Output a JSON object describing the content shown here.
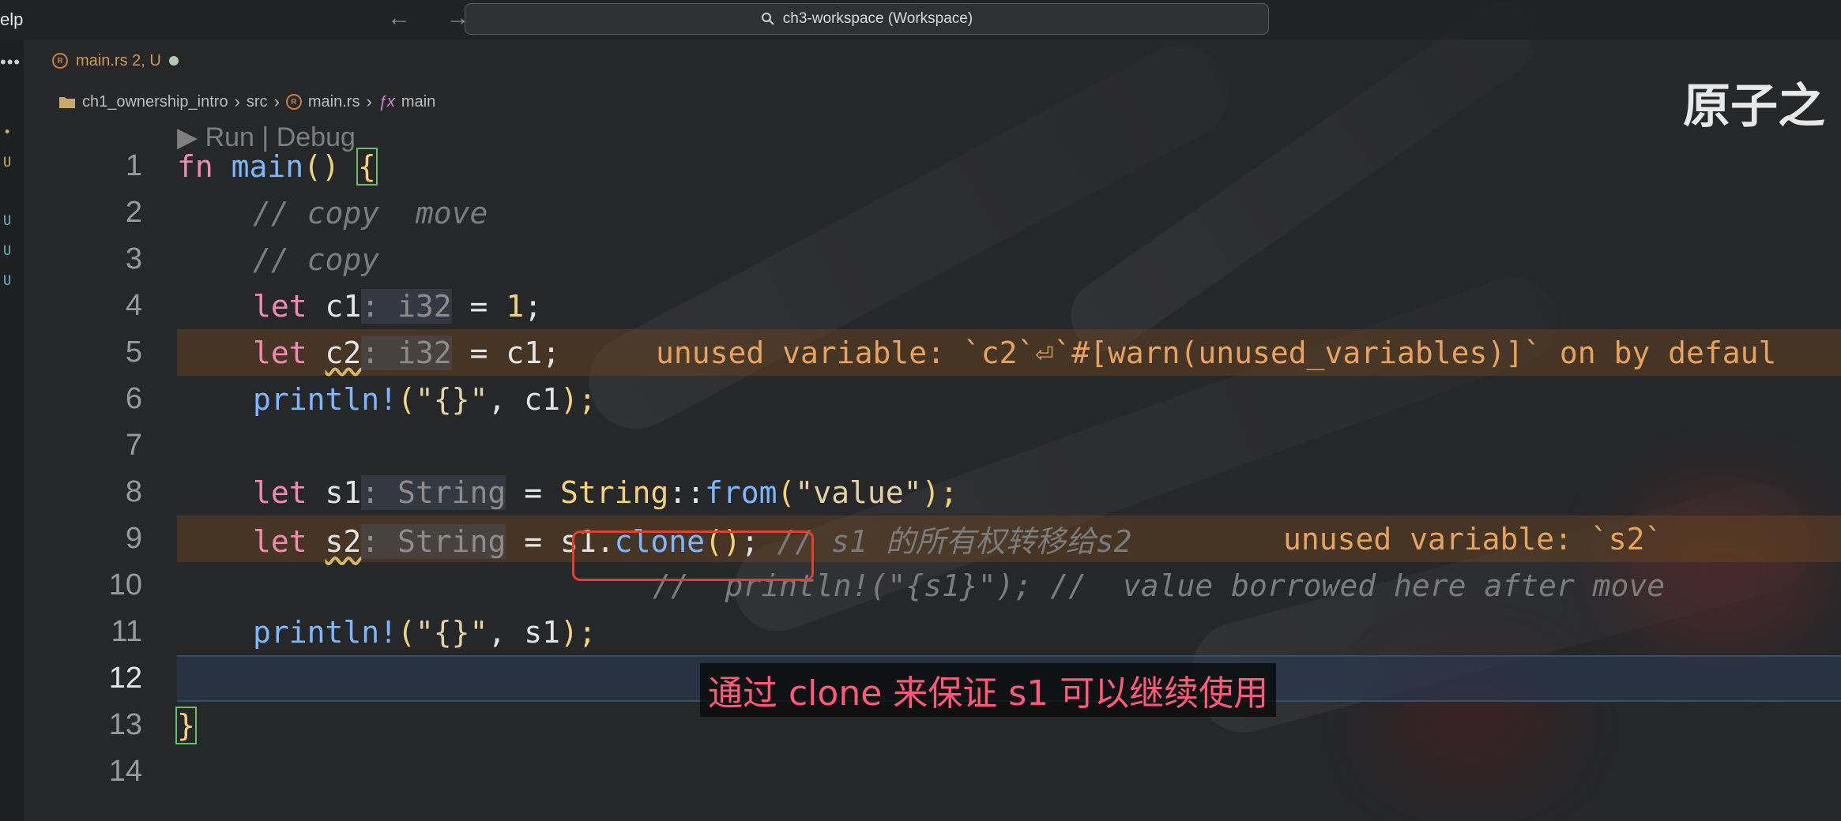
{
  "titlebar": {
    "menu_help": "elp",
    "nav_arrows": "← →",
    "search_label": "ch3-workspace (Workspace)"
  },
  "activity": {
    "dots": "•••",
    "marks": [
      "•",
      "U",
      "U",
      "U",
      "U"
    ]
  },
  "tab": {
    "label": "main.rs 2, U"
  },
  "breadcrumb": {
    "items": [
      "ch1_ownership_intro",
      "src",
      "main.rs",
      "main"
    ]
  },
  "watermark": "原子之",
  "codelens": "▶ Run | Debug",
  "code": {
    "line_numbers": [
      "1",
      "2",
      "3",
      "4",
      "5",
      "6",
      "7",
      "8",
      "9",
      "10",
      "11",
      "12",
      "13",
      "14"
    ],
    "l1": {
      "kw": "fn",
      "name": "main",
      "parens": "() ",
      "brace": "{"
    },
    "l2": "// copy  move",
    "l3": "// copy",
    "l4": {
      "kw": "let",
      "var": " c1",
      "inlay": ": i32",
      "rest": " = ",
      "num": "1",
      "end": ";"
    },
    "l5": {
      "kw": "let",
      "var": "c2",
      "inlay": ": i32",
      "rest": " = c1;",
      "warn": "unused variable: `c2`⏎`#[warn(unused_variables)]` on by defaul"
    },
    "l6": {
      "mac": "println!",
      "open": "(",
      "str": "\"{}\"",
      "rest": ", c1",
      "close": ");"
    },
    "l8": {
      "kw": "let",
      "var": " s1",
      "inlay": ": String",
      "rest": " = ",
      "ty": "String",
      "sep": "::",
      "fn": "from",
      "open": "(",
      "str": "\"value\"",
      "close": ");"
    },
    "l9": {
      "kw": "let",
      "var": "s2",
      "inlay": ": String",
      "rest": " = ",
      "call": "s1.",
      "fn": "clone",
      "parens": "()",
      "end": ";",
      "com": " // s1 的所有权转移给s2",
      "warn": "unused variable: `s2`"
    },
    "l10": "//  println!(\"{s1}\"); //  value borrowed here after move",
    "l11": {
      "mac": "println!",
      "open": "(",
      "str": "\"{}\"",
      "rest": ", s1",
      "close": ");"
    },
    "l13": "}"
  },
  "subtitle": "通过 clone 来保证 s1 可以继续使用"
}
